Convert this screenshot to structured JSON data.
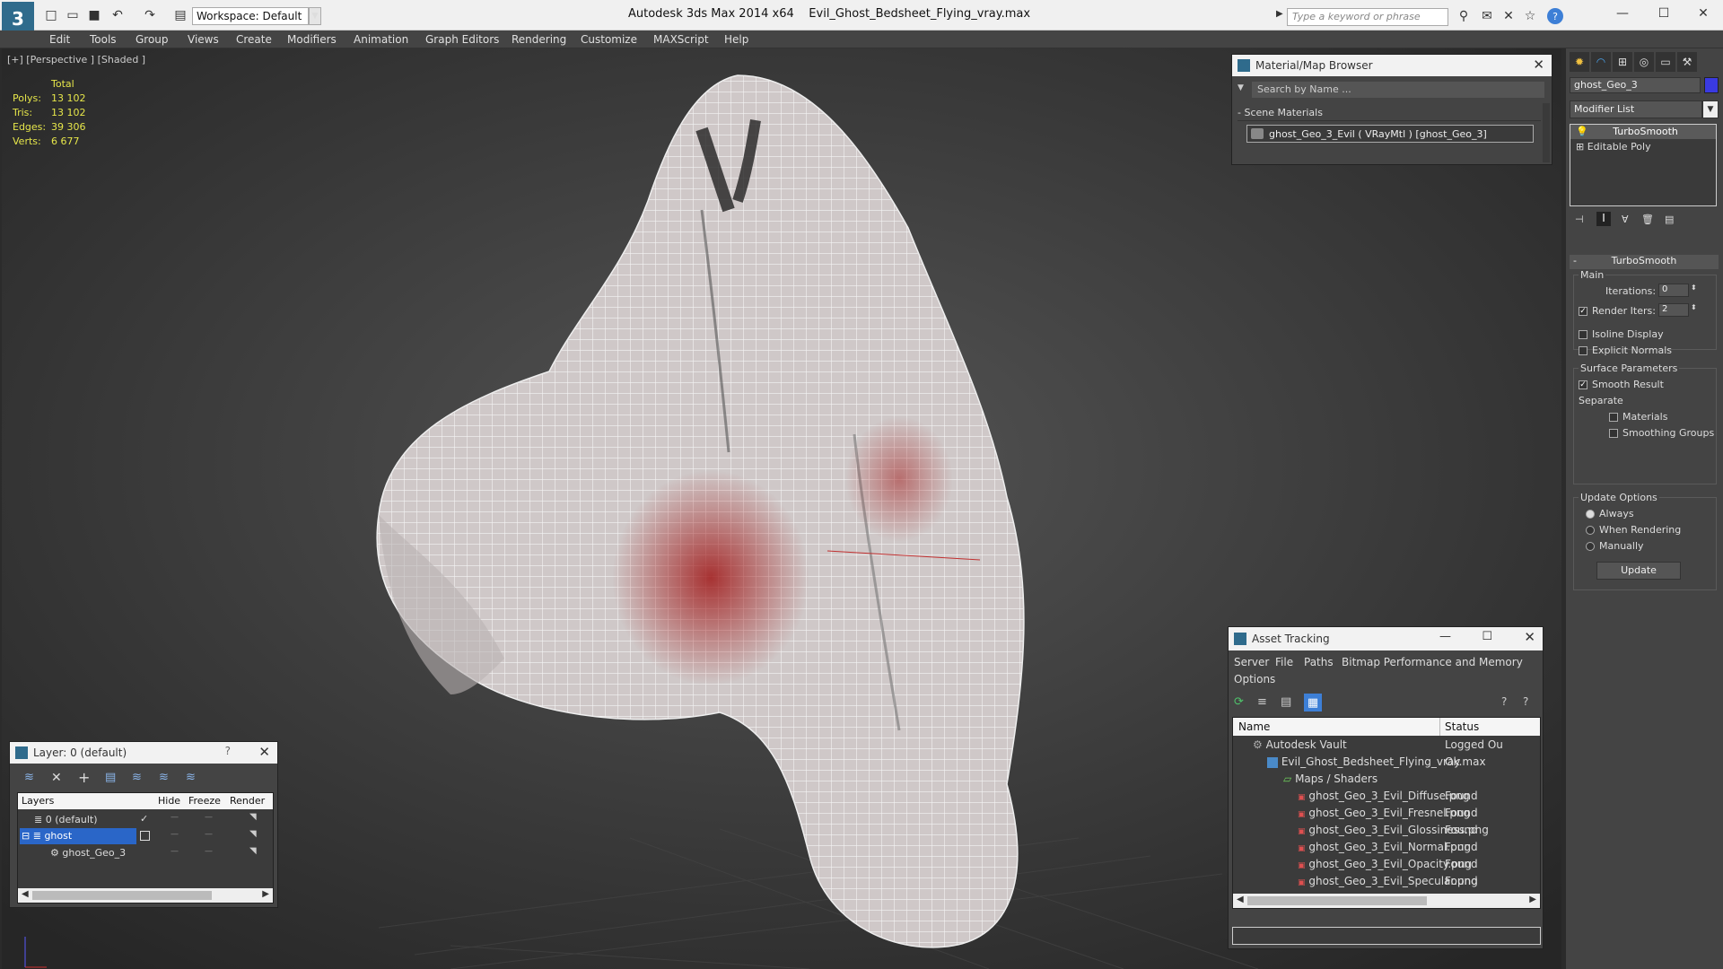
{
  "app": {
    "title": "Autodesk 3ds Max  2014 x64",
    "file": "Evil_Ghost_Bedsheet_Flying_vray.max",
    "workspace": "Workspace: Default",
    "keyword_placeholder": "Type a keyword or phrase"
  },
  "menu": [
    "Edit",
    "Tools",
    "Group",
    "Views",
    "Create",
    "Modifiers",
    "Animation",
    "Graph Editors",
    "Rendering",
    "Customize",
    "MAXScript",
    "Help"
  ],
  "viewport": {
    "label": "[+] [Perspective ] [Shaded ]",
    "stats_header": "Total",
    "stats": [
      {
        "label": "Polys:",
        "value": "13 102"
      },
      {
        "label": "Tris:",
        "value": "13 102"
      },
      {
        "label": "Edges:",
        "value": "39 306"
      },
      {
        "label": "Verts:",
        "value": "6 677"
      }
    ]
  },
  "material_browser": {
    "title": "Material/Map Browser",
    "search_placeholder": "Search by Name ...",
    "section": "Scene Materials",
    "item": "ghost_Geo_3_Evil  ( VRayMtl ) [ghost_Geo_3]"
  },
  "asset_tracking": {
    "title": "Asset Tracking",
    "menu": [
      "Server",
      "File",
      "Paths",
      "Bitmap Performance and Memory",
      "Options"
    ],
    "columns": [
      "Name",
      "Status"
    ],
    "rows": [
      {
        "name": "Autodesk Vault",
        "status": "Logged Ou"
      },
      {
        "name": "Evil_Ghost_Bedsheet_Flying_vray.max",
        "status": "Ok"
      },
      {
        "name": "Maps / Shaders",
        "status": ""
      },
      {
        "name": "ghost_Geo_3_Evil_Diffuse.png",
        "status": "Found"
      },
      {
        "name": "ghost_Geo_3_Evil_Fresnel.png",
        "status": "Found"
      },
      {
        "name": "ghost_Geo_3_Evil_Glossiness.png",
        "status": "Found"
      },
      {
        "name": "ghost_Geo_3_Evil_Normal.png",
        "status": "Found"
      },
      {
        "name": "ghost_Geo_3_Evil_Opacity.png",
        "status": "Found"
      },
      {
        "name": "ghost_Geo_3_Evil_Specular.png",
        "status": "Found"
      }
    ]
  },
  "layer_panel": {
    "title": "Layer: 0 (default)",
    "help": "?",
    "columns": [
      "Layers",
      "Hide",
      "Freeze",
      "Render"
    ],
    "rows": [
      {
        "name": "0 (default)"
      },
      {
        "name": "ghost"
      },
      {
        "name": "ghost_Geo_3"
      }
    ]
  },
  "command_panel": {
    "object_name": "ghost_Geo_3",
    "modifier_list": "Modifier List",
    "stack": [
      "TurboSmooth",
      "Editable Poly"
    ],
    "rollout_title": "TurboSmooth",
    "main_label": "Main",
    "iterations_label": "Iterations:",
    "iterations_value": "0",
    "render_iters_label": "Render Iters:",
    "render_iters_value": "2",
    "isoline": "Isoline Display",
    "explicit": "Explicit Normals",
    "surface_label": "Surface Parameters",
    "smooth_result": "Smooth Result",
    "separate_label": "Separate",
    "materials": "Materials",
    "smoothing_groups": "Smoothing Groups",
    "update_label": "Update Options",
    "always": "Always",
    "when_rendering": "When Rendering",
    "manually": "Manually",
    "update_button": "Update"
  },
  "colors": {
    "accent": "#3d7fd6",
    "selection": "#2a66c8",
    "stats_text": "#e6e64a"
  }
}
